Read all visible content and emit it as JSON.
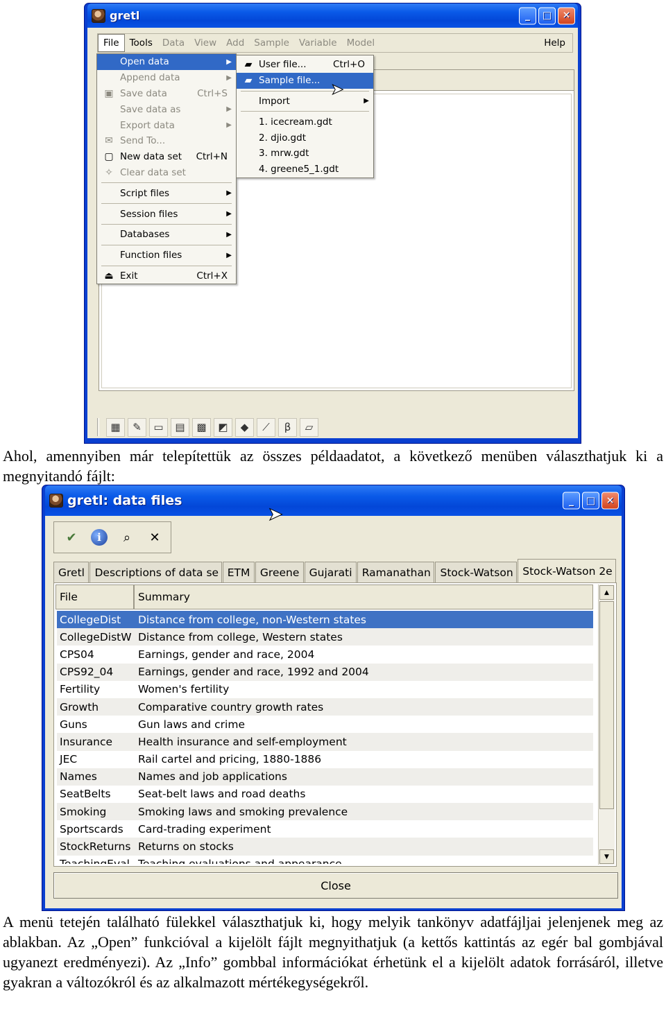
{
  "window1": {
    "title": "gretl",
    "menubar": [
      "File",
      "Tools",
      "Data",
      "View",
      "Add",
      "Sample",
      "Variable",
      "Model"
    ],
    "help": "Help",
    "file_menu": [
      {
        "label": "Open data",
        "icon": "",
        "shortcut": "",
        "submenu": true,
        "enabled": true,
        "highlight": true
      },
      {
        "label": "Append data",
        "icon": "",
        "shortcut": "",
        "submenu": true,
        "enabled": false
      },
      {
        "label": "Save data",
        "icon": "save-icon",
        "shortcut": "Ctrl+S",
        "enabled": false
      },
      {
        "label": "Save data as",
        "icon": "",
        "shortcut": "",
        "submenu": true,
        "enabled": false
      },
      {
        "label": "Export data",
        "icon": "",
        "shortcut": "",
        "submenu": true,
        "enabled": false
      },
      {
        "label": "Send To...",
        "icon": "mail-icon",
        "shortcut": "",
        "enabled": false
      },
      {
        "label": "New data set",
        "icon": "new-document-icon",
        "shortcut": "Ctrl+N",
        "enabled": true
      },
      {
        "label": "Clear data set",
        "icon": "broom-icon",
        "shortcut": "",
        "enabled": false
      },
      {
        "sep": true
      },
      {
        "label": "Script files",
        "submenu": true,
        "enabled": true
      },
      {
        "sep": true
      },
      {
        "label": "Session files",
        "submenu": true,
        "enabled": true
      },
      {
        "sep": true
      },
      {
        "label": "Databases",
        "submenu": true,
        "enabled": true
      },
      {
        "sep": true
      },
      {
        "label": "Function files",
        "submenu": true,
        "enabled": true
      },
      {
        "sep": true
      },
      {
        "label": "Exit",
        "icon": "exit-icon",
        "shortcut": "Ctrl+X",
        "enabled": true
      }
    ],
    "open_submenu": [
      {
        "label": "User file...",
        "icon": "folder-icon",
        "shortcut": "Ctrl+O"
      },
      {
        "label": "Sample file...",
        "icon": "folder-icon",
        "shortcut": "",
        "highlight": true
      },
      {
        "sep": true
      },
      {
        "label": "Import",
        "submenu": true
      },
      {
        "sep": true
      },
      {
        "label": "1. icecream.gdt"
      },
      {
        "label": "2. djio.gdt"
      },
      {
        "label": "3. mrw.gdt"
      },
      {
        "label": "4. greene5_1.gdt"
      }
    ]
  },
  "paragraph1": "Ahol, amennyiben már telepítettük az összes példaadatot, a következő menüben választhatjuk ki a megnyitandó fájlt:",
  "window2": {
    "title": "gretl: data files",
    "tabs": [
      "Gretl",
      "Descriptions of data se",
      "ETM",
      "Greene",
      "Gujarati",
      "Ramanathan",
      "Stock-Watson",
      "Stock-Watson 2e"
    ],
    "active_tab": 7,
    "columns": {
      "file": "File",
      "summary": "Summary"
    },
    "rows": [
      {
        "file": "CollegeDist",
        "summary": "Distance from college, non-Western states",
        "selected": true
      },
      {
        "file": "CollegeDistW",
        "summary": "Distance from college, Western states"
      },
      {
        "file": "CPS04",
        "summary": "Earnings, gender and race, 2004"
      },
      {
        "file": "CPS92_04",
        "summary": "Earnings, gender and race, 1992 and 2004"
      },
      {
        "file": "Fertility",
        "summary": "Women's fertility"
      },
      {
        "file": "Growth",
        "summary": "Comparative country growth rates"
      },
      {
        "file": "Guns",
        "summary": "Gun laws and crime"
      },
      {
        "file": "Insurance",
        "summary": "Health insurance and self-employment"
      },
      {
        "file": "JEC",
        "summary": "Rail cartel and pricing, 1880-1886"
      },
      {
        "file": "Names",
        "summary": "Names and job applications"
      },
      {
        "file": "SeatBelts",
        "summary": "Seat-belt laws and road deaths"
      },
      {
        "file": "Smoking",
        "summary": "Smoking laws and smoking prevalence"
      },
      {
        "file": "Sportscards",
        "summary": "Card-trading experiment"
      },
      {
        "file": "StockReturns",
        "summary": "Returns on stocks"
      },
      {
        "file": "TeachingEval",
        "summary": "Teaching evaluations and appearance"
      }
    ],
    "close_label": "Close"
  },
  "paragraph2": "A menü tetején található fülekkel választhatjuk ki, hogy melyik tankönyv adatfájljai jelenjenek meg az ablakban. Az „Open” funkcióval a kijelölt fájlt megnyithatjuk (a kettős kattintás az egér bal gombjával ugyanezt eredményezi). Az „Info” gombbal információkat érhetünk el a kijelölt adatok forrásáról, illetve gyakran a változókról és az alkalmazott mértékegységekről."
}
